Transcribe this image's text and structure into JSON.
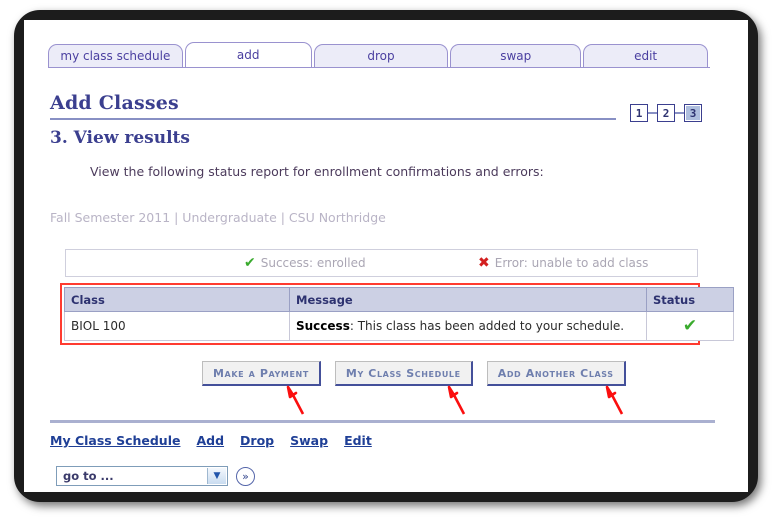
{
  "tabs": [
    {
      "label": "my class schedule",
      "active": false
    },
    {
      "label": "add",
      "active": true
    },
    {
      "label": "drop",
      "active": false
    },
    {
      "label": "swap",
      "active": false
    },
    {
      "label": "edit",
      "active": false
    }
  ],
  "header": {
    "page_title": "Add Classes",
    "step_title": "3. View results",
    "instruction": "View the following status report for enrollment confirmations and errors:",
    "term_line": "Fall Semester 2011 | Undergraduate | CSU Northridge"
  },
  "steps": {
    "items": [
      "1",
      "2",
      "3"
    ],
    "current": "3"
  },
  "legend": {
    "success_icon": "check-icon",
    "success_label": "Success: enrolled",
    "error_icon": "x-icon",
    "error_label": "Error: unable to add class"
  },
  "results_table": {
    "columns": [
      "Class",
      "Message",
      "Status"
    ],
    "rows": [
      {
        "class": "BIOL  100",
        "message_label": "Success",
        "message_text": ": This class has been added to your schedule.",
        "status_icon": "check-icon"
      }
    ]
  },
  "actions": [
    {
      "label": "Make a Payment"
    },
    {
      "label": "My Class Schedule"
    },
    {
      "label": "Add Another Class"
    }
  ],
  "footer_links": [
    {
      "label": "My Class Schedule"
    },
    {
      "label": "Add"
    },
    {
      "label": "Drop"
    },
    {
      "label": "Swap"
    },
    {
      "label": "Edit"
    }
  ],
  "goto": {
    "value": "go to ...",
    "go_label": "»"
  },
  "colors": {
    "accent": "#3b3f8f",
    "tab_border": "#9a92cf",
    "success": "#3aab2e",
    "error": "#d32020",
    "annotation": "#ff3b30",
    "table_header_bg": "#ccd0e4"
  }
}
